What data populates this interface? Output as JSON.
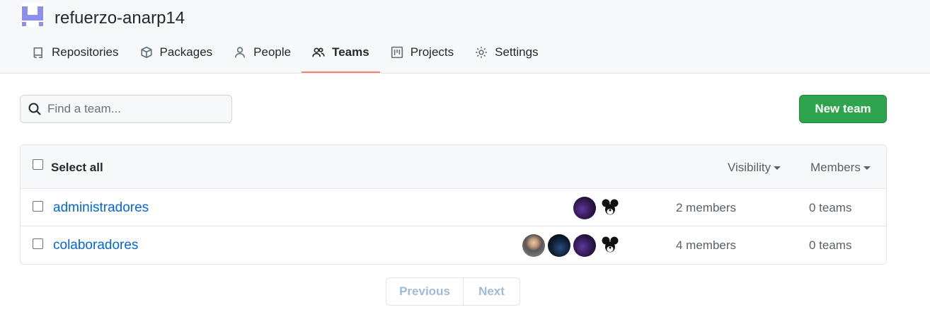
{
  "org": {
    "name": "refuerzo-anarp14",
    "avatar_icon": "org-identicon"
  },
  "tabs": [
    {
      "label": "Repositories",
      "icon": "repo-icon"
    },
    {
      "label": "Packages",
      "icon": "package-icon"
    },
    {
      "label": "People",
      "icon": "person-icon"
    },
    {
      "label": "Teams",
      "icon": "people-icon",
      "active": true
    },
    {
      "label": "Projects",
      "icon": "project-icon"
    },
    {
      "label": "Settings",
      "icon": "gear-icon"
    }
  ],
  "search": {
    "placeholder": "Find a team...",
    "value": ""
  },
  "new_team_label": "New team",
  "table": {
    "select_all": "Select all",
    "visibility": "Visibility",
    "members": "Members",
    "rows": [
      {
        "name": "administradores",
        "members": "2 members",
        "teams": "0 teams"
      },
      {
        "name": "colaboradores",
        "members": "4 members",
        "teams": "0 teams"
      }
    ]
  },
  "pagination": {
    "previous": "Previous",
    "next": "Next"
  },
  "colors": {
    "accent": "#f9826c",
    "primary": "#2ea44f",
    "link": "#0366d6"
  }
}
